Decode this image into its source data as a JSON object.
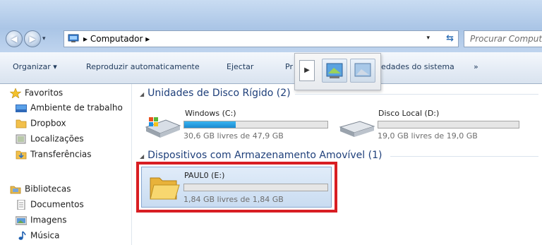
{
  "address": {
    "crumb": "Computador",
    "separator": "▸"
  },
  "search": {
    "placeholder": "Procurar Computador"
  },
  "toolbar": {
    "organize": "Organizar ▾",
    "autoplay": "Reproduzir automaticamente",
    "eject": "Ejectar",
    "properties_partial": "Pr",
    "system_properties_partial": "iedades do sistema",
    "more": "»"
  },
  "nav": {
    "favorites": "Favoritos",
    "desktop": "Ambiente de trabalho",
    "dropbox": "Dropbox",
    "locations": "Localizações",
    "downloads": "Transferências",
    "libraries": "Bibliotecas",
    "documents": "Documentos",
    "images": "Imagens",
    "music": "Música"
  },
  "sections": {
    "hdd": "Unidades de Disco Rígido (2)",
    "removable": "Dispositivos com Armazenamento Amovível (1)"
  },
  "drives": {
    "c": {
      "name": "Windows (C:)",
      "info": "30,6 GB livres de 47,9 GB",
      "used_fraction": 0.36
    },
    "d": {
      "name": "Disco Local (D:)",
      "info": "19,0 GB livres de 19,0 GB",
      "used_fraction": 0.0
    },
    "e": {
      "name": "PAUL0 (E:)",
      "info": "1,84 GB livres de 1,84 GB",
      "used_fraction": 0.0
    }
  },
  "colors": {
    "highlight_border": "#d81e23",
    "bar_fill": "#1c8ad0"
  }
}
